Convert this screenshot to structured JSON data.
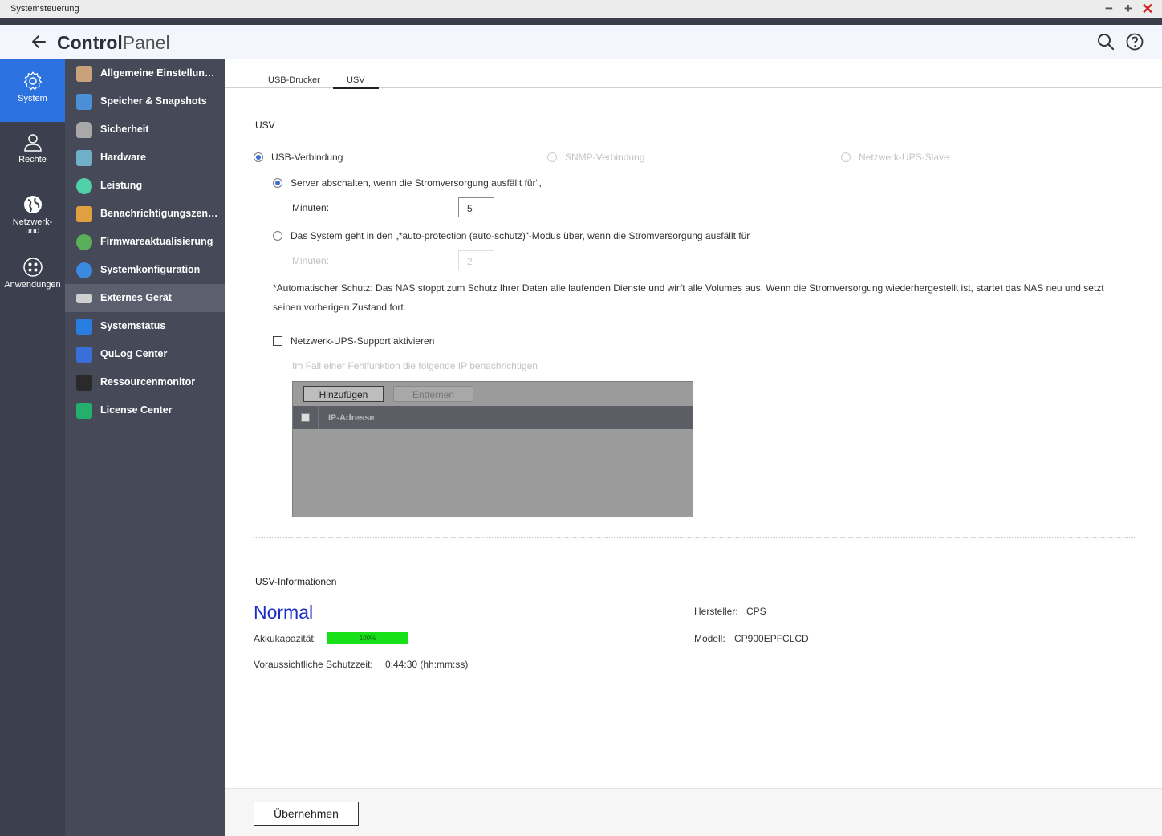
{
  "window": {
    "title": "Systemsteuerung"
  },
  "header": {
    "title_bold": "Control",
    "title_light": "Panel"
  },
  "rail": [
    {
      "label": "System",
      "icon": "gear-icon"
    },
    {
      "label": "Rechte",
      "icon": "user-icon"
    },
    {
      "label": "Netzwerk-\nund",
      "icon": "globe-icon"
    },
    {
      "label": "Anwendungen",
      "icon": "apps-icon"
    }
  ],
  "subnav": [
    {
      "label": "Allgemeine Einstellungen",
      "color": "#c9a27a"
    },
    {
      "label": "Speicher & Snapshots",
      "color": "#4a8fd8"
    },
    {
      "label": "Sicherheit",
      "color": "#a8a8a8"
    },
    {
      "label": "Hardware",
      "color": "#6fb0c8"
    },
    {
      "label": "Leistung",
      "color": "#4fd0a8"
    },
    {
      "label": "Benachrichtigungszentru…",
      "color": "#e0a040"
    },
    {
      "label": "Firmwareaktualisierung",
      "color": "#5ab058"
    },
    {
      "label": "Systemkonfiguration",
      "color": "#3a8ae0"
    },
    {
      "label": "Externes Gerät",
      "color": "#cfcfcf"
    },
    {
      "label": "Systemstatus",
      "color": "#2a7de0"
    },
    {
      "label": "QuLog Center",
      "color": "#3a6ed8"
    },
    {
      "label": "Ressourcenmonitor",
      "color": "#2a2a2a"
    },
    {
      "label": "License Center",
      "color": "#23b06a"
    }
  ],
  "tabs": {
    "t1": "USB-Drucker",
    "t2": "USV"
  },
  "ups": {
    "section_title": "USV",
    "mode_usb": "USB-Verbindung",
    "mode_snmp": "SNMP-Verbindung",
    "mode_slave": "Netzwerk-UPS-Slave",
    "opt_shutdown": "Server abschalten, wenn die Stromversorgung ausfällt für“,",
    "minutes_label": "Minuten:",
    "minutes_value": "5",
    "opt_autoprotect": "Das System geht in den „*auto-protection (auto-schutz)“-Modus über, wenn die Stromversorgung ausfällt für",
    "minutes2_label": "Minuten:",
    "minutes2_value": "2",
    "note_line1": "*Automatischer Schutz: Das NAS stoppt zum Schutz Ihrer Daten alle laufenden Dienste und wirft alle Volumes aus. Wenn die Stromversorgung wiederhergestellt ist, startet das NAS neu und setzt",
    "note_line2": "seinen vorherigen Zustand fort.",
    "network_support": "Netzwerk-UPS-Support aktivieren",
    "notify_label": "Im Fall einer Fehlfunktion die folgende IP benachrichtigen",
    "btn_add": "Hinzufügen",
    "btn_remove": "Entfernen",
    "col_ip": "IP-Adresse"
  },
  "info": {
    "title": "USV-Informationen",
    "status": "Normal",
    "battery_label": "Akkukapazität:",
    "battery_value": "100%",
    "battery_fraction": 1.0,
    "runtime_label": "Voraussichtliche Schutzzeit:",
    "runtime_value": "0:44:30 (hh:mm:ss)",
    "maker_label": "Hersteller:",
    "maker_value": "CPS",
    "model_label": "Modell:",
    "model_value": "CP900EPFCLCD"
  },
  "footer": {
    "apply": "Übernehmen"
  },
  "colors": {
    "accent": "#2b71e0",
    "status": "#1b2fc7",
    "battery": "#18e018"
  }
}
